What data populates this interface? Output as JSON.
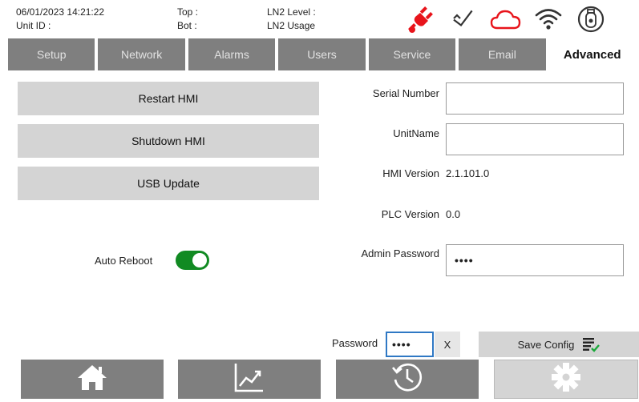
{
  "header": {
    "datetime": "06/01/2023 14:21:22",
    "unit_id_label": "Unit ID :",
    "top_label": "Top :",
    "bot_label": "Bot :",
    "ln2_level_label": "LN2 Level :",
    "ln2_usage_label": "LN2 Usage",
    "icons": [
      "power-disconnected-icon",
      "checkmark-icon",
      "cloud-icon",
      "wifi-icon",
      "gas-tank-icon"
    ],
    "colors": {
      "alert": "#e8141b",
      "normal": "#333333"
    }
  },
  "tabs": [
    {
      "label": "Setup"
    },
    {
      "label": "Network"
    },
    {
      "label": "Alarms"
    },
    {
      "label": "Users"
    },
    {
      "label": "Service"
    },
    {
      "label": "Email"
    },
    {
      "label": "Advanced",
      "active": true
    }
  ],
  "actions": {
    "restart_label": "Restart HMI",
    "shutdown_label": "Shutdown HMI",
    "usb_label": "USB Update"
  },
  "auto_reboot": {
    "label": "Auto Reboot",
    "enabled": true,
    "color": "#118a22"
  },
  "fields": {
    "serial_number_label": "Serial Number",
    "serial_number_value": "",
    "unit_name_label": "UnitName",
    "unit_name_value": "",
    "hmi_version_label": "HMI Version",
    "hmi_version_value": "2.1.101.0",
    "plc_version_label": "PLC Version",
    "plc_version_value": "0.0",
    "admin_password_label": "Admin Password",
    "admin_password_value": "••••"
  },
  "footer_form": {
    "password_label": "Password",
    "password_value": "••••",
    "clear_label": "X",
    "save_label": "Save Config"
  },
  "nav": {
    "items": [
      "home-icon",
      "chart-icon",
      "history-icon",
      "settings-icon"
    ],
    "active": "settings-icon"
  }
}
